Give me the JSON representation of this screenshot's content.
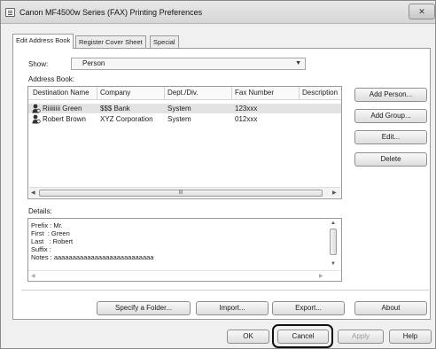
{
  "window": {
    "title": "Canon MF4500w Series (FAX) Printing Preferences",
    "close_label": "✕"
  },
  "tabs": [
    {
      "label": "Edit Address Book",
      "active": true
    },
    {
      "label": "Register Cover Sheet",
      "active": false
    },
    {
      "label": "Special",
      "active": false
    }
  ],
  "show": {
    "label": "Show:",
    "value": "Person"
  },
  "address_book": {
    "label": "Address Book:",
    "columns": [
      "Destination Name",
      "Company",
      "Dept./Div.",
      "Fax Number",
      "Description"
    ],
    "rows": [
      {
        "name": "Riiiiiiii Green",
        "company": "$$$ Bank",
        "dept": "System",
        "fax": "123xxx",
        "description": "",
        "selected": true
      },
      {
        "name": "Robert Brown",
        "company": "XYZ Corporation",
        "dept": "System",
        "fax": "012xxx",
        "description": "",
        "selected": false
      }
    ],
    "scroll_grip": "III"
  },
  "side_buttons": {
    "add_person": "Add Person...",
    "add_group": "Add Group...",
    "edit": "Edit...",
    "delete": "Delete"
  },
  "details": {
    "label": "Details:",
    "lines": [
      "Prefix : Mr.",
      "First  : Green",
      "Last   : Robert",
      "Suffix :",
      "Notes : aaaaaaaaaaaaaaaaaaaaaaaaaaa"
    ]
  },
  "bottom_buttons": {
    "specify_folder": "Specify a Folder...",
    "import": "Import...",
    "export": "Export...",
    "about": "About"
  },
  "dialog_buttons": {
    "ok": "OK",
    "cancel": "Cancel",
    "apply": "Apply",
    "help": "Help"
  }
}
